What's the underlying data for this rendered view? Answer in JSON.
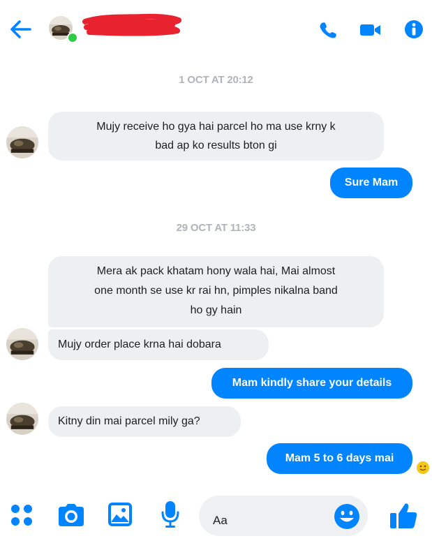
{
  "header": {
    "back_icon": "arrow-left-icon",
    "call_icon": "phone-icon",
    "video_icon": "video-camera-icon",
    "info_icon": "info-icon",
    "accent": "#0084ff",
    "online": true
  },
  "messages": {
    "timestamp_1": "1 OCT AT 20:12",
    "in_1_line1": "Mujy receive ho gya hai parcel ho ma use krny k",
    "in_1_line2": "bad ap ko results bton gi",
    "out_1": "Sure Mam",
    "timestamp_2": "29 OCT AT 11:33",
    "in_2_line1": "Mera ak pack khatam hony wala hai, Mai almost",
    "in_2_line2": "one month se use kr rai hn, pimples nikalna band",
    "in_2_line3": "ho gy hain",
    "in_3": "Mujy order place krna hai dobara",
    "out_2": "Mam kindly share your details",
    "in_4": "Kitny din mai parcel mily ga?",
    "out_3": "Mam 5 to 6 days mai"
  },
  "composer": {
    "placeholder": "Aa",
    "icons": [
      "grid-menu-icon",
      "camera-icon",
      "image-icon",
      "microphone-icon",
      "emoji-icon",
      "thumbs-up-icon"
    ]
  },
  "colors": {
    "incoming_bubble": "#eeeff1",
    "outgoing_bubble": "#0084ff",
    "timestamp": "#b0b3b8"
  }
}
